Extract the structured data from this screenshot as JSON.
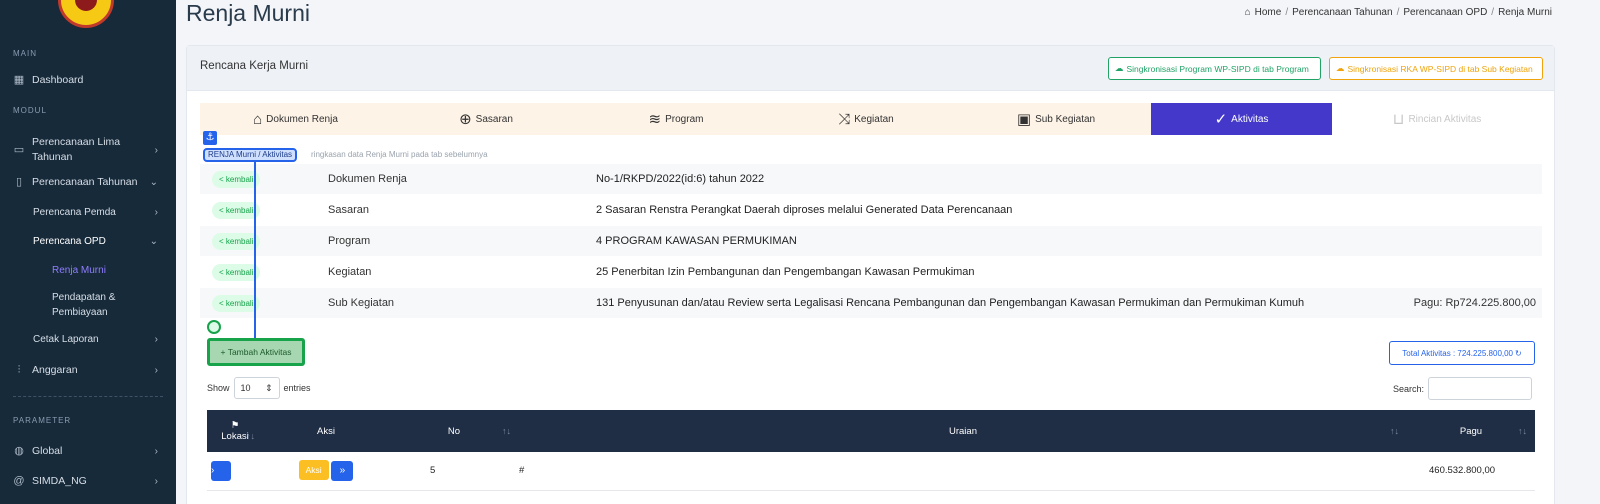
{
  "sidebar": {
    "section_main": "MAIN",
    "dashboard": "Dashboard",
    "section_modul": "MODUL",
    "renstra": "Perencanaan Lima Tahunan",
    "tahunan": "Perencanaan Tahunan",
    "pemda": "Perencana Pemda",
    "opd": "Perencana OPD",
    "renja_murni": "Renja Murni",
    "pendapatan": "Pendapatan & Pembiayaan",
    "cetak": "Cetak Laporan",
    "anggaran": "Anggaran",
    "section_parameter": "PARAMETER",
    "global": "Global",
    "simda": "SIMDA_NG",
    "active_color": "#8f7dff"
  },
  "header": {
    "title": "Renja Murni",
    "breadcrumb": [
      "Home",
      "Perencanaan Tahunan",
      "Perencanaan OPD",
      "Renja Murni"
    ]
  },
  "card": {
    "title": "Rencana Kerja Murni",
    "sync_program": "Singkronisasi Program WP-SIPD di tab Program",
    "sync_rka": "Singkronisasi RKA WP-SIPD di tab Sub Kegiatan"
  },
  "tabs": [
    {
      "label": "Dokumen Renja",
      "icon": "home-icon"
    },
    {
      "label": "Sasaran",
      "icon": "crosshair-icon"
    },
    {
      "label": "Program",
      "icon": "layers-icon"
    },
    {
      "label": "Kegiatan",
      "icon": "shuffle-icon"
    },
    {
      "label": "Sub Kegiatan",
      "icon": "kanban-icon"
    },
    {
      "label": "Aktivitas",
      "icon": "check-circle-icon"
    },
    {
      "label": "Rincian Aktivitas",
      "icon": "cart-icon"
    }
  ],
  "summary": {
    "tag": "RENJA Murni / Aktivitas",
    "hint": "ringkasan data Renja Murni pada tab sebelumnya",
    "back_label": "< kembali",
    "rows": [
      {
        "label": "Dokumen Renja",
        "value": "No-1/RKPD/2022(id:6) tahun 2022",
        "extra": ""
      },
      {
        "label": "Sasaran",
        "value": "2 Sasaran Renstra Perangkat Daerah diproses melalui Generated Data Perencanaan",
        "extra": ""
      },
      {
        "label": "Program",
        "value": "4 PROGRAM KAWASAN PERMUKIMAN",
        "extra": ""
      },
      {
        "label": "Kegiatan",
        "value": "25 Penerbitan Izin Pembangunan dan Pengembangan Kawasan Permukiman",
        "extra": ""
      },
      {
        "label": "Sub Kegiatan",
        "value": "131 Penyusunan dan/atau Review serta Legalisasi Rencana Pembangunan dan Pengembangan Kawasan Permukiman dan Permukiman Kumuh",
        "extra": "Pagu: Rp724.225.800,00"
      }
    ]
  },
  "actions": {
    "add": "+ Tambah Aktivitas",
    "total": "Total Aktivitas : 724.225.800,00"
  },
  "table_controls": {
    "show": "Show",
    "entries_value": "10",
    "entries": "entries",
    "search": "Search:"
  },
  "table": {
    "headers": [
      "Lokasi",
      "Aksi",
      "No",
      "Uraian",
      "Pagu"
    ],
    "rows": [
      {
        "aksi": "Aksi",
        "no": "5",
        "uraian": "#",
        "pagu": "460.532.800,00"
      }
    ]
  }
}
